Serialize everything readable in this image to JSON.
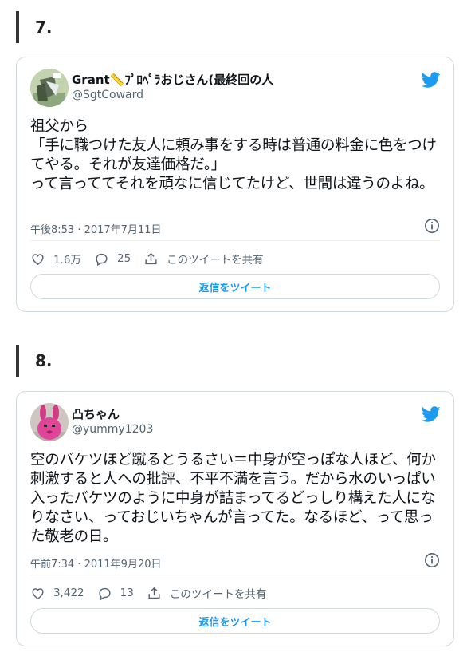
{
  "sections": [
    {
      "number": "7.",
      "tweet": {
        "display_name": "Grant📏ﾌﾟﾛﾍﾟﾗおじさん(最終回の人",
        "handle": "@SgtCoward",
        "text": "祖父から\n「手に職つけた友人に頼み事をする時は普通の料金に色をつけてやる。それが友達価格だ。」\nって言っててそれを頑なに信じてたけど、世間は違うのよね。",
        "timestamp": "午後8:53 · 2017年7月11日",
        "likes": "1.6万",
        "replies": "25",
        "share_label": "このツイートを共有",
        "reply_button_label": "返信をツイート",
        "avatar_icon": "avatar-photo"
      }
    },
    {
      "number": "8.",
      "tweet": {
        "display_name": "凸ちゃん",
        "handle": "@yummy1203",
        "text": "空のバケツほど蹴るとうるさい＝中身が空っぽな人ほど、何か刺激すると人への批評、不平不満を言う。だから水のいっぱい入ったバケツのように中身が詰まってるどっしり構えた人になりなさい、っておじいちゃんが言ってた。なるほど、って思った敬老の日。",
        "timestamp": "午前7:34 · 2011年9月20日",
        "likes": "3,422",
        "replies": "13",
        "share_label": "このツイートを共有",
        "reply_button_label": "返信をツイート",
        "avatar_icon": "pink-rabbit-avatar"
      }
    }
  ],
  "colors": {
    "twitter_blue": "#1d9bf0",
    "secondary_text": "#536471",
    "border": "#cfd9de"
  }
}
